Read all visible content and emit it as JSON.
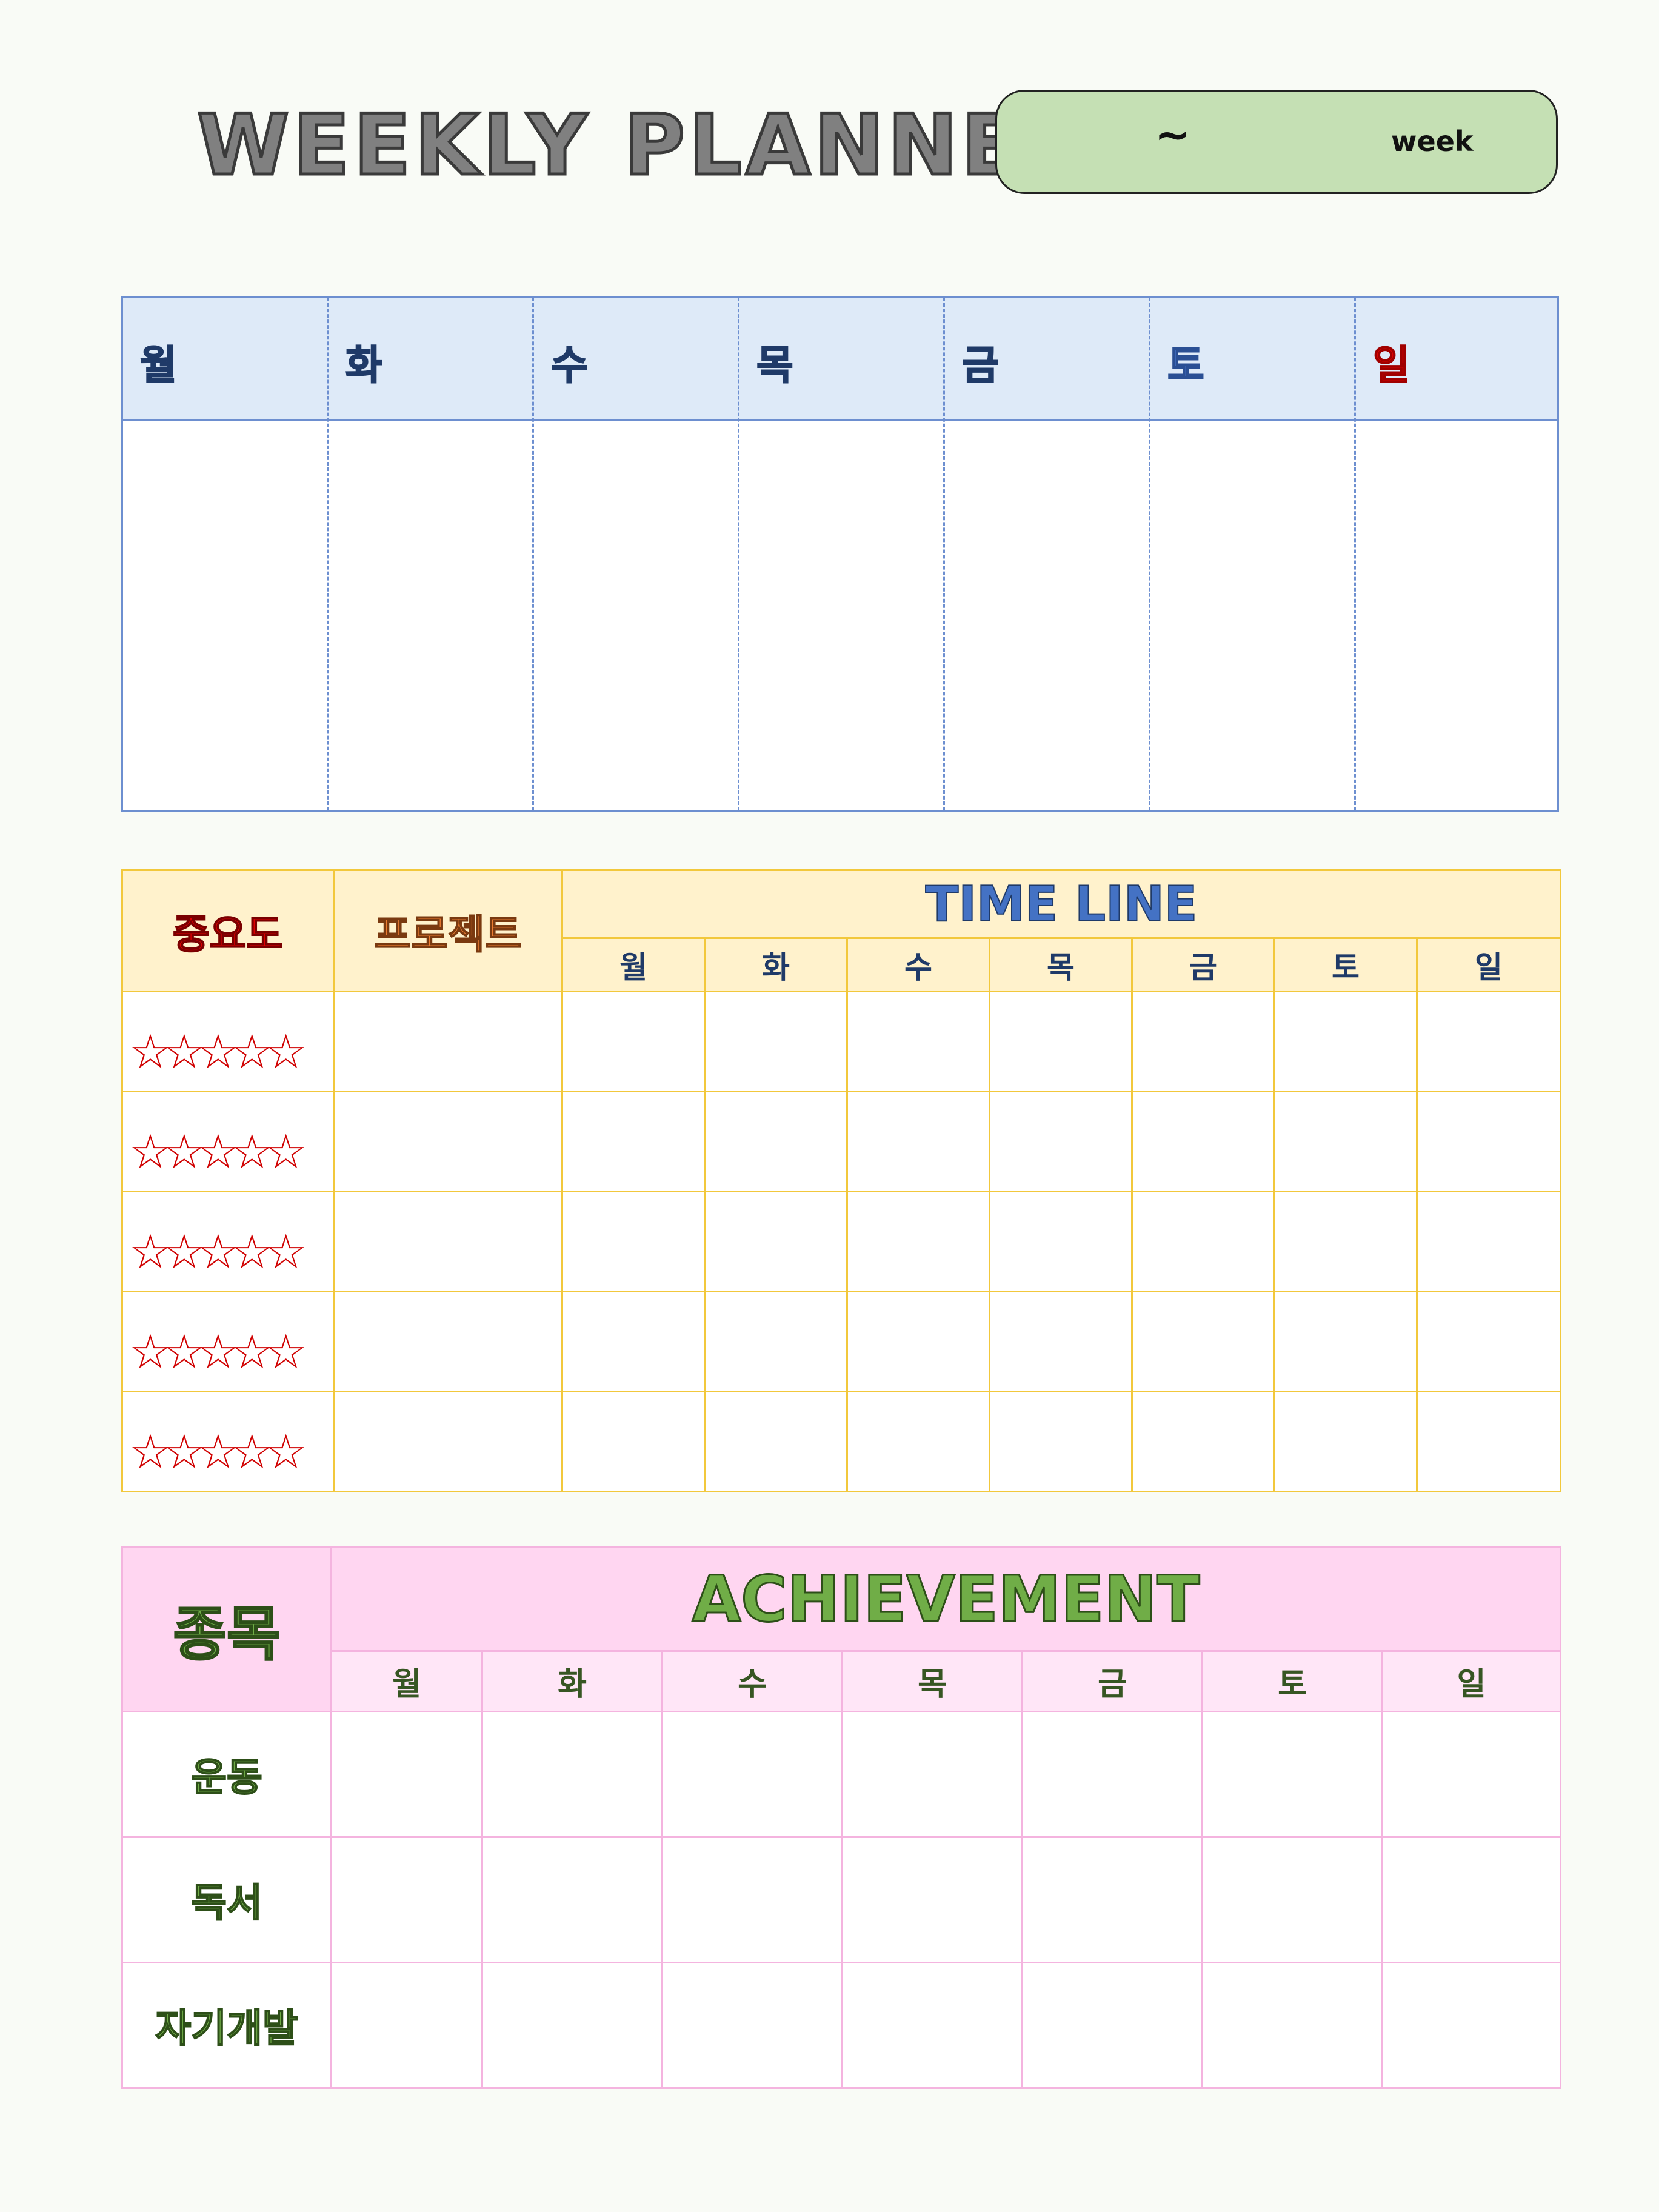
{
  "header": {
    "title": "WEEKLY PLANNER",
    "week_range_separator": "~",
    "week_label": "week"
  },
  "weekly": {
    "days": [
      {
        "label": "월",
        "color": "#1f3a68"
      },
      {
        "label": "화",
        "color": "#1f3a68"
      },
      {
        "label": "수",
        "color": "#1f3a68"
      },
      {
        "label": "목",
        "color": "#1f3a68"
      },
      {
        "label": "금",
        "color": "#1f3a68"
      },
      {
        "label": "토",
        "color": "#4472c4"
      },
      {
        "label": "일",
        "color": "#e00000"
      }
    ]
  },
  "timeline": {
    "importance_header": "중요도",
    "project_header": "프로젝트",
    "title": "TIME LINE",
    "days": [
      "월",
      "화",
      "수",
      "목",
      "금",
      "토",
      "일"
    ],
    "rows": [
      {
        "stars": "☆☆☆☆☆"
      },
      {
        "stars": "☆☆☆☆☆"
      },
      {
        "stars": "☆☆☆☆☆"
      },
      {
        "stars": "☆☆☆☆☆"
      },
      {
        "stars": "☆☆☆☆☆"
      }
    ]
  },
  "achievement": {
    "category_header": "종목",
    "title": "ACHIEVEMENT",
    "days": [
      "월",
      "화",
      "수",
      "목",
      "금",
      "토",
      "일"
    ],
    "rows": [
      {
        "label": "운동"
      },
      {
        "label": "독서"
      },
      {
        "label": "자기개발"
      }
    ]
  },
  "colors": {
    "background": "#f9fbf6",
    "week_box": "#c5e0b4",
    "weekly_header": "#deeaf8",
    "weekly_border": "#6d8fd0",
    "timeline_header": "#fff2cc",
    "timeline_border": "#f2c83c",
    "achievement_header": "#ffd6f1",
    "achievement_border": "#f4b4df",
    "achievement_text": "#70ad47"
  }
}
